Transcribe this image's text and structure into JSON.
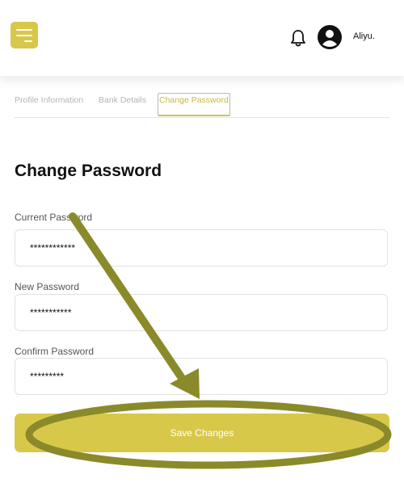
{
  "header": {
    "username": "Aliyu.",
    "icons": {
      "menu": "hamburger-menu-icon",
      "notifications": "bell-icon",
      "avatar": "user-avatar-icon"
    },
    "accent_color": "#d8c84a"
  },
  "tabs": [
    {
      "label": "Profile Information",
      "active": false
    },
    {
      "label": "Bank Details",
      "active": false
    },
    {
      "label": "Change Password",
      "active": true
    }
  ],
  "form": {
    "title": "Change Password",
    "fields": [
      {
        "label": "Current Password",
        "value": "************"
      },
      {
        "label": "New Password",
        "value": "***********"
      },
      {
        "label": "Confirm Password",
        "value": "*********"
      }
    ],
    "save_label": "Save Changes"
  },
  "annotation": {
    "arrow_color": "#8a8a2a",
    "highlight": "ellipse around save button"
  }
}
